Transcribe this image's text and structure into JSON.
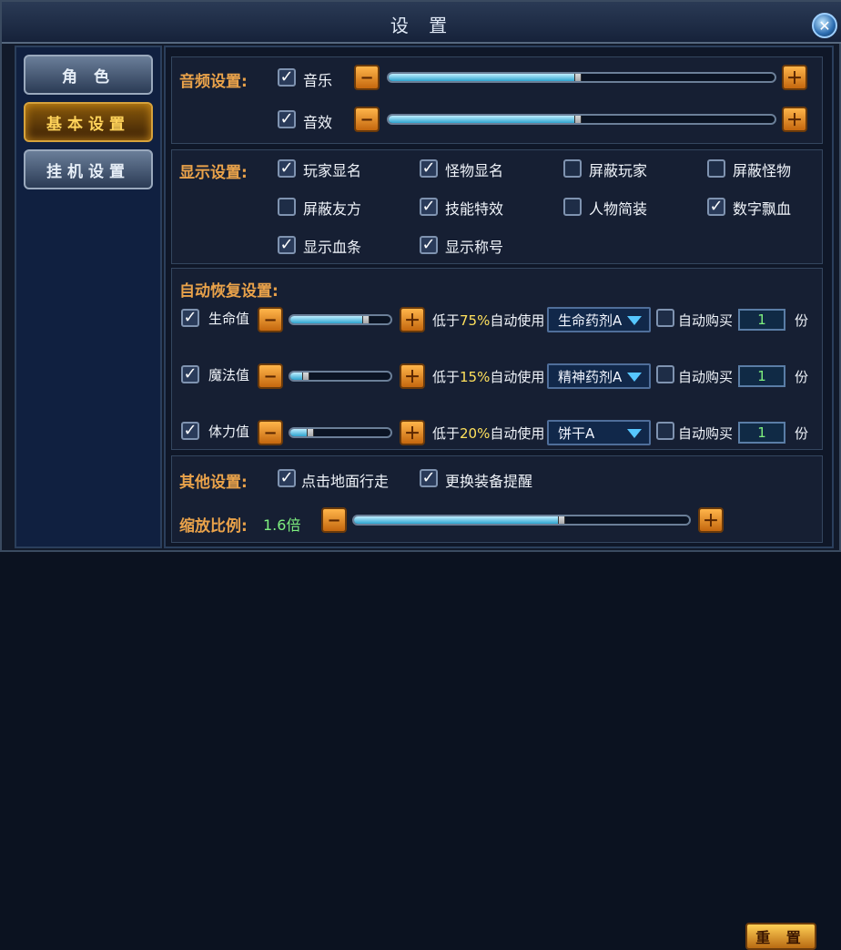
{
  "window": {
    "title": "设 置",
    "close_icon": "close-icon"
  },
  "sidebar": {
    "items": [
      {
        "label": "角 色",
        "state": "normal"
      },
      {
        "label": "基本设置",
        "state": "active"
      },
      {
        "label": "挂机设置",
        "state": "normal"
      }
    ]
  },
  "audio": {
    "section_label": "音频设置:",
    "rows": [
      {
        "enabled": true,
        "label": "音乐",
        "level": 0.49
      },
      {
        "enabled": true,
        "label": "音效",
        "level": 0.49
      }
    ]
  },
  "display": {
    "section_label": "显示设置:",
    "options": [
      {
        "label": "玩家显名",
        "checked": true
      },
      {
        "label": "怪物显名",
        "checked": true
      },
      {
        "label": "屏蔽玩家",
        "checked": false
      },
      {
        "label": "屏蔽怪物",
        "checked": false
      },
      {
        "label": "屏蔽友方",
        "checked": false
      },
      {
        "label": "技能特效",
        "checked": true
      },
      {
        "label": "人物简装",
        "checked": false
      },
      {
        "label": "数字飘血",
        "checked": true
      },
      {
        "label": "显示血条",
        "checked": true
      },
      {
        "label": "显示称号",
        "checked": true
      }
    ]
  },
  "recovery": {
    "section_label": "自动恢复设置:",
    "rows": [
      {
        "enabled": true,
        "label": "生命值",
        "level": 0.75,
        "percent_text": "75%",
        "prefix": "低于",
        "suffix": "自动使用",
        "potion": "生命药剂A",
        "auto_buy_label": "自动购买",
        "auto_buy_checked": false,
        "qty": "1",
        "unit": "份"
      },
      {
        "enabled": true,
        "label": "魔法值",
        "level": 0.15,
        "percent_text": "15%",
        "prefix": "低于",
        "suffix": "自动使用",
        "potion": "精神药剂A",
        "auto_buy_label": "自动购买",
        "auto_buy_checked": false,
        "qty": "1",
        "unit": "份"
      },
      {
        "enabled": true,
        "label": "体力值",
        "level": 0.2,
        "percent_text": "20%",
        "prefix": "低于",
        "suffix": "自动使用",
        "potion": "饼干A",
        "auto_buy_label": "自动购买",
        "auto_buy_checked": false,
        "qty": "1",
        "unit": "份"
      }
    ]
  },
  "other": {
    "section_label": "其他设置:",
    "options": [
      {
        "label": "点击地面行走",
        "checked": true
      },
      {
        "label": "更换装备提醒",
        "checked": true
      }
    ]
  },
  "zoom": {
    "label": "缩放比例:",
    "value_text": "1.6倍",
    "level": 0.62,
    "reset_label": "重 置"
  },
  "icons": {
    "minus": "minus-icon",
    "plus": "plus-icon",
    "checkbox": "check-icon",
    "dropdown": "chevron-down-icon"
  },
  "colors": {
    "accent": "#e9a24a",
    "active_tab": "#ffd35a",
    "slider_fill": "#2ea4cf",
    "percent": "#ffe15c",
    "qty": "#7ff07f"
  }
}
